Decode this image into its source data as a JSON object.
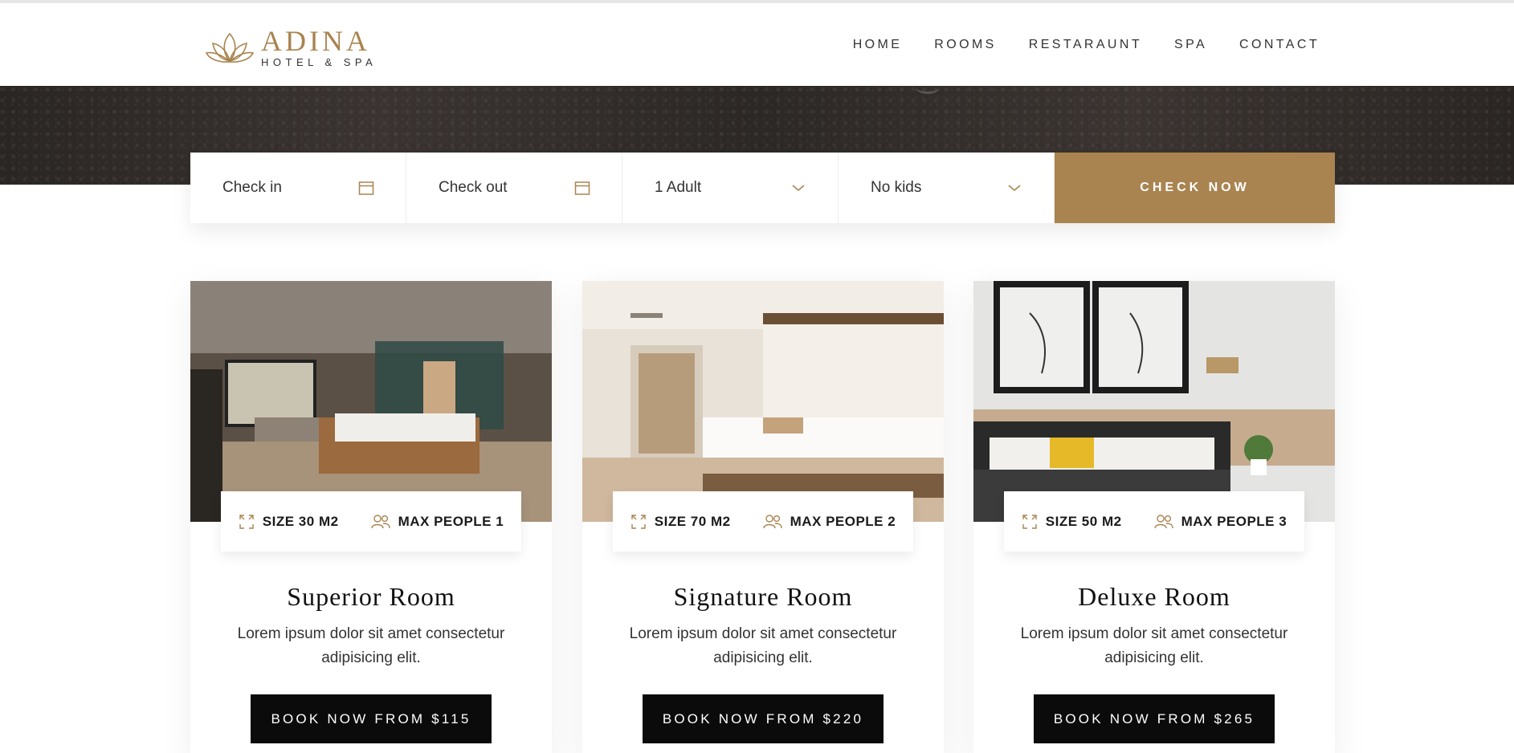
{
  "brand": {
    "name": "ADINA",
    "tagline": "HOTEL & SPA",
    "accent_color": "#a98450",
    "logo_icon": "lotus-icon"
  },
  "nav": {
    "items": [
      "HOME",
      "ROOMS",
      "RESTARAUNT",
      "SPA",
      "CONTACT"
    ]
  },
  "booking": {
    "check_in": "Check in",
    "check_out": "Check out",
    "adults": "1 Adult",
    "kids": "No kids",
    "submit": "CHECK NOW",
    "calendar_icon": "calendar-icon",
    "dropdown_icon": "chevron-down-icon"
  },
  "rooms": [
    {
      "title": "Superior Room",
      "size": "SIZE 30 M2",
      "people": "MAX PEOPLE 1",
      "desc": "Lorem ipsum dolor sit amet consectetur adipisicing elit.",
      "cta": "BOOK NOW FROM $115"
    },
    {
      "title": "Signature Room",
      "size": "SIZE 70 M2",
      "people": "MAX PEOPLE 2",
      "desc": "Lorem ipsum dolor sit amet consectetur adipisicing elit.",
      "cta": "BOOK NOW FROM $220"
    },
    {
      "title": "Deluxe Room",
      "size": "SIZE 50 M2",
      "people": "MAX PEOPLE 3",
      "desc": "Lorem ipsum dolor sit amet consectetur adipisicing elit.",
      "cta": "BOOK NOW FROM $265"
    }
  ]
}
